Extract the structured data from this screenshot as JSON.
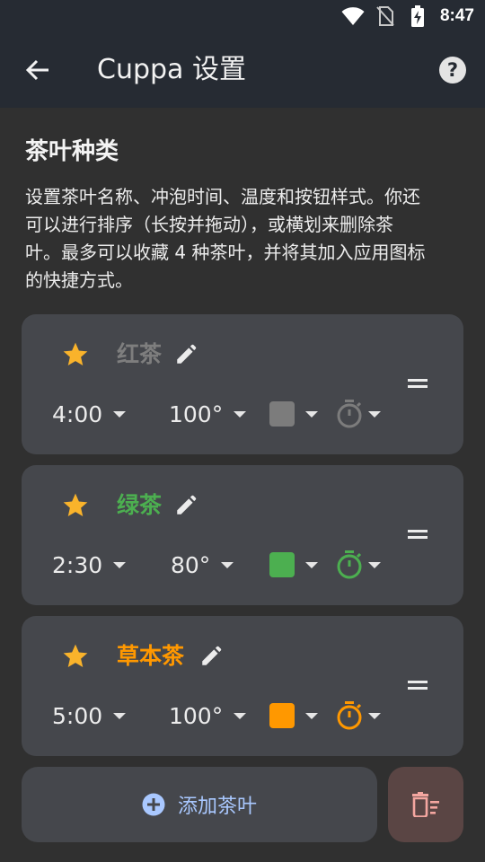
{
  "status_bar": {
    "time": "8:47"
  },
  "app_bar": {
    "title": "Cuppa 设置"
  },
  "section": {
    "title": "茶叶种类",
    "description_lines": [
      "设置茶叶名称、冲泡时间、温度和按钮样式。你还",
      "可以进行排序（长按并拖动），或横划来删除茶",
      "叶。最多可以收藏 4 种茶叶，并将其加入应用图标",
      "的快捷方式。"
    ]
  },
  "teas": [
    {
      "name": "红茶",
      "time": "4:00",
      "temperature": "100°",
      "color": "#7c7c7c",
      "name_color": "#7e7e7e",
      "favorite": true
    },
    {
      "name": "绿茶",
      "time": "2:30",
      "temperature": "80°",
      "color": "#4caf50",
      "name_color": "#4caf50",
      "favorite": true
    },
    {
      "name": "草本茶",
      "time": "5:00",
      "temperature": "100°",
      "color": "#ff9800",
      "name_color": "#ff9800",
      "favorite": true
    }
  ],
  "actions": {
    "add_label": "添加茶叶"
  },
  "colors": {
    "background": "#303030",
    "app_bar": "#262b33",
    "card": "#45474c",
    "star": "#f9b32b",
    "accent": "#a9c8ff",
    "delete_bg": "#5a4544",
    "delete_icon": "#f4a6a0"
  }
}
